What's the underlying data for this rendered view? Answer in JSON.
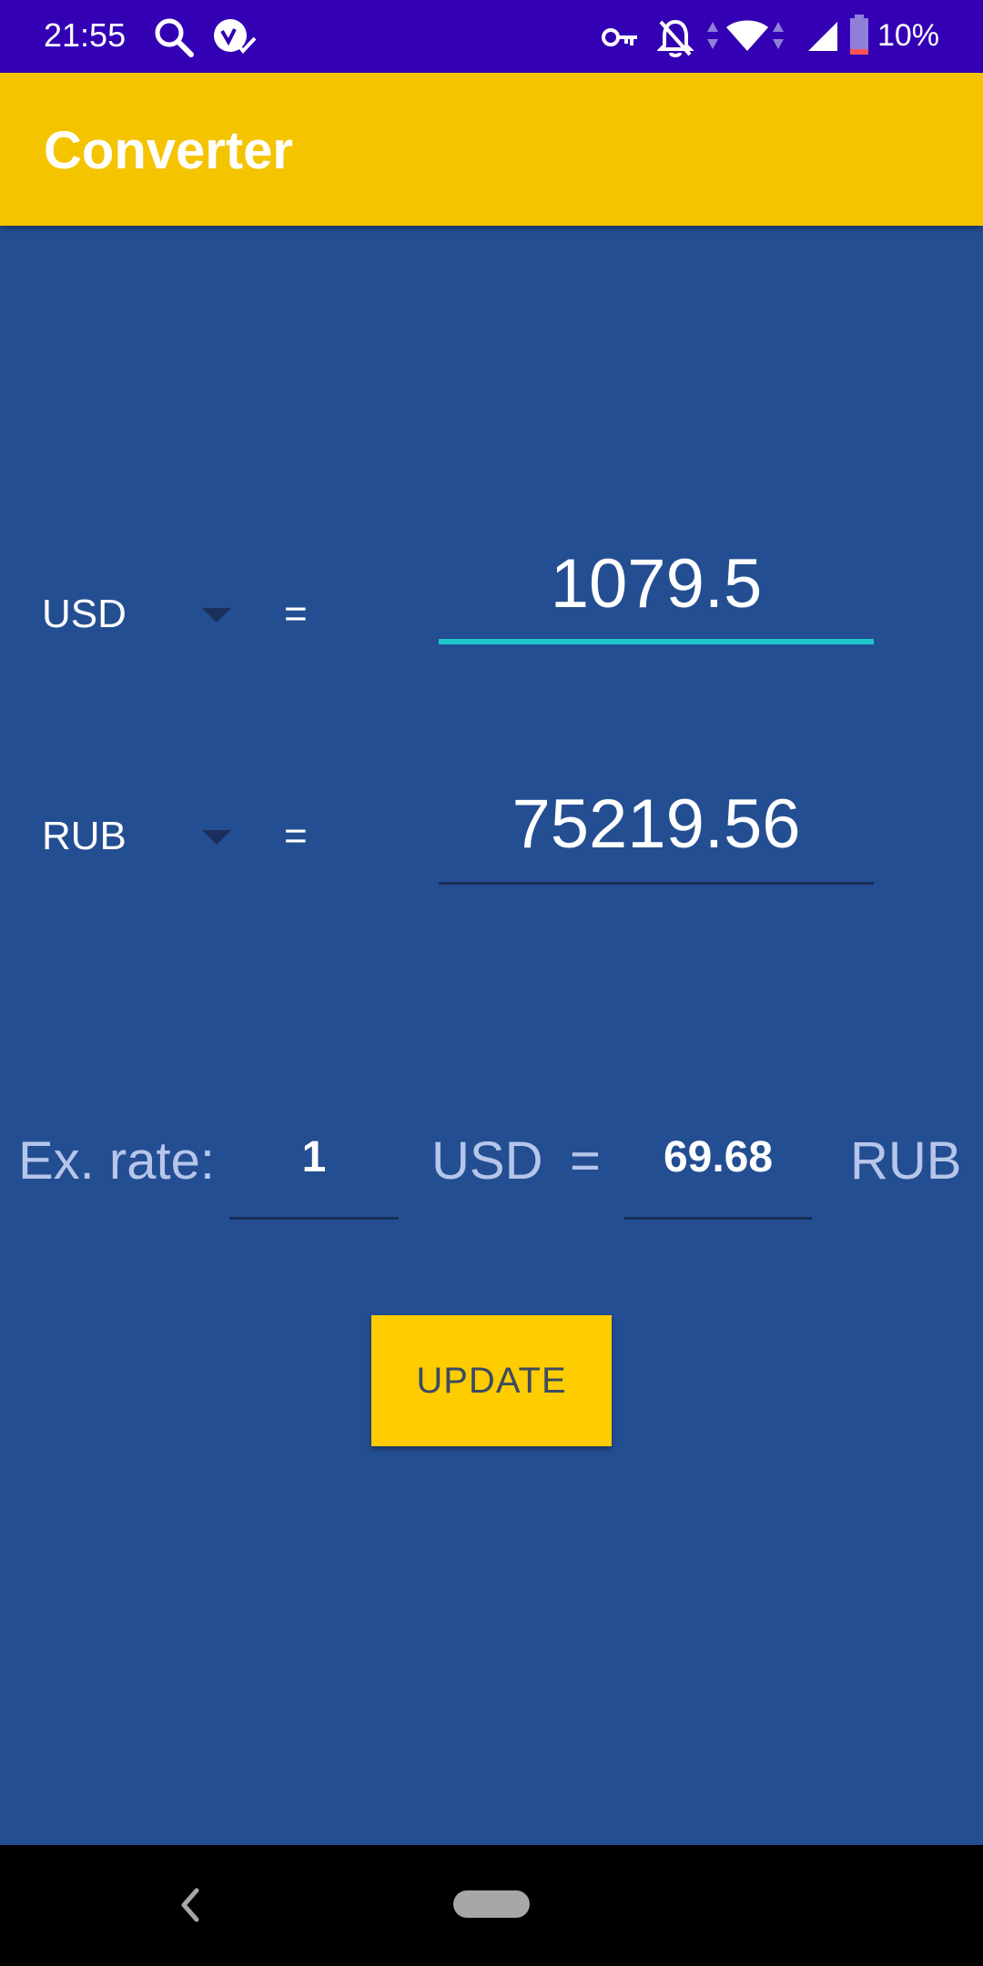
{
  "status_bar": {
    "time": "21:55",
    "battery": "10%"
  },
  "app_bar": {
    "title": "Converter"
  },
  "converter": {
    "rows": [
      {
        "currency": "USD",
        "equals": "=",
        "amount": "1079.5"
      },
      {
        "currency": "RUB",
        "equals": "=",
        "amount": "75219.56"
      }
    ]
  },
  "rate": {
    "label": "Ex. rate:",
    "from_amount": "1",
    "from_currency": "USD",
    "equals": "=",
    "to_amount": "69.68",
    "to_currency": "RUB"
  },
  "update_label": "UPDATE",
  "colors": {
    "status_bar": "#3300b3",
    "app_bar": "#f5c400",
    "background": "#244e92",
    "button": "#ffcc00",
    "focused_underline": "#1ec8c8"
  }
}
